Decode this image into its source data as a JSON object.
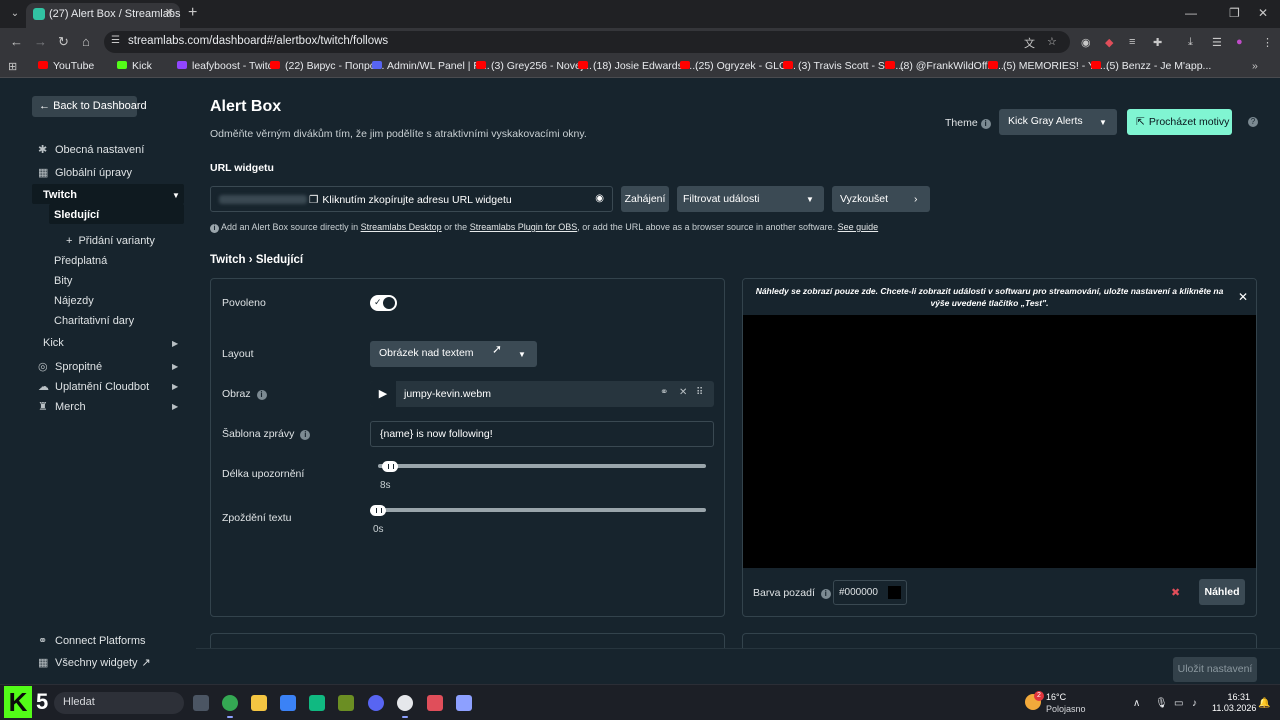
{
  "browser": {
    "tab_title": "(27) Alert Box / Streamlabs",
    "url": "streamlabs.com/dashboard#/alertbox/twitch/follows",
    "bookmarks": [
      {
        "label": "YouTube",
        "color": "#ff0000"
      },
      {
        "label": "Kick",
        "color": "#53fc18"
      },
      {
        "label": "leafyboost - Twitch",
        "color": "#9146ff"
      },
      {
        "label": "(22) Вирус - Попро...",
        "color": "#ff0000"
      },
      {
        "label": "Admin/WL Panel | R...",
        "color": "#5865f2"
      },
      {
        "label": "(3) Grey256 - Novej...",
        "color": "#ff0000"
      },
      {
        "label": "(18) Josie Edwards -...",
        "color": "#ff0000"
      },
      {
        "label": "(25) Ogryzek - GLO...",
        "color": "#ff0000"
      },
      {
        "label": "(3) Travis Scott - SIC...",
        "color": "#ff0000"
      },
      {
        "label": "(8) @FrankWildOffic...",
        "color": "#ff0000"
      },
      {
        "label": "(5) MEMORIES! - Yo...",
        "color": "#ff0000"
      },
      {
        "label": "(5) Benzz - Je M'app...",
        "color": "#ff0000"
      }
    ]
  },
  "sidebar": {
    "back_label": "Back to Dashboard",
    "items": [
      {
        "label": "Obecná nastavení",
        "icon": "gear-icon"
      },
      {
        "label": "Globální úpravy",
        "icon": "grid-icon"
      },
      {
        "label": "Twitch"
      },
      {
        "label": "Sledující"
      },
      {
        "label": "Přidání varianty"
      },
      {
        "label": "Předplatná"
      },
      {
        "label": "Bity"
      },
      {
        "label": "Nájezdy"
      },
      {
        "label": "Charitativní dary"
      },
      {
        "label": "Kick"
      },
      {
        "label": "Spropitné",
        "icon": "tip-icon"
      },
      {
        "label": "Uplatnění Cloudbot",
        "icon": "cloudbot-icon"
      },
      {
        "label": "Merch",
        "icon": "shirt-icon"
      }
    ],
    "footer": [
      {
        "label": "Connect Platforms",
        "icon": "link-icon"
      },
      {
        "label": "Všechny widgety",
        "icon": "grid-icon"
      }
    ]
  },
  "header": {
    "title": "Alert Box",
    "subtitle": "Odměňte věrným divákům tím, že jim podělíte s atraktivními vyskakovacími okny.",
    "theme_label": "Theme",
    "theme_value": "Kick Gray Alerts",
    "browse_label": "Procházet motivy"
  },
  "widget_url": {
    "label": "URL widgetu",
    "copy_label": "Kliknutím zkopírujte adresu URL widgetu",
    "launch_label": "Zahájení",
    "filter_label": "Filtrovat události",
    "test_label": "Vyzkoušet",
    "hint_prefix": "Add an Alert Box source directly in",
    "hint_link1": "Streamlabs Desktop",
    "hint_mid1": "or the",
    "hint_link2": "Streamlabs Plugin for OBS",
    "hint_mid2": ", or add the URL above as a browser source in another software.",
    "hint_link3": "See guide"
  },
  "breadcrumb": {
    "parent": "Twitch",
    "separator": "›",
    "current": "Sledující"
  },
  "settings": {
    "enabled_label": "Povoleno",
    "enabled": true,
    "layout_label": "Layout",
    "layout_value": "Obrázek nad textem",
    "image_label": "Obraz",
    "image_file": "jumpy-kevin.webm",
    "template_label": "Šablona zprávy",
    "template_value": "{name} is now following!",
    "duration_label": "Délka upozornění",
    "duration_value": "8s",
    "duration_fraction": 0.02,
    "delay_label": "Zpoždění textu",
    "delay_value": "0s",
    "delay_fraction": 0.0
  },
  "preview": {
    "note": "Náhledy se zobrazí pouze zde. Chcete-li zobrazit události v softwaru pro streamování, uložte nastavení a klikněte na výše uvedené tlačítko „Test\".",
    "bg_label": "Barva pozadí",
    "bg_value": "#000000",
    "preview_label": "Náhled"
  },
  "save_label": "Uložit nastavení",
  "taskbar": {
    "search_placeholder": "Hledat",
    "weather_temp": "16°C",
    "weather_desc": "Polojasno",
    "weather_badge": "2",
    "time": "16:31",
    "date": "11.03.2026"
  },
  "colors": {
    "accent": "#80f5d2",
    "background": "#17242d",
    "kick_green": "#53fc18"
  }
}
